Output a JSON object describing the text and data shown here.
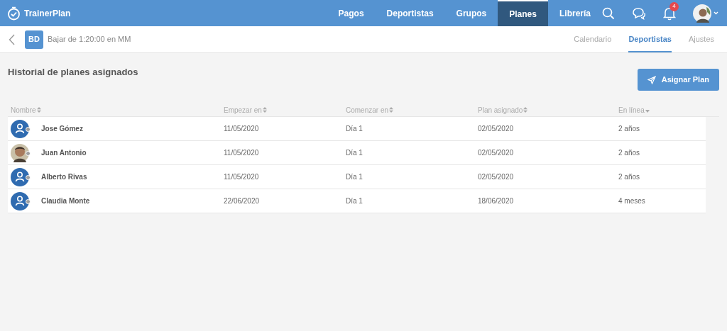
{
  "app": {
    "name": "TrainerPlan"
  },
  "nav": [
    {
      "label": "Pagos",
      "selected": false
    },
    {
      "label": "Deportistas",
      "selected": false
    },
    {
      "label": "Grupos",
      "selected": false
    },
    {
      "label": "Planes",
      "selected": true
    },
    {
      "label": "Librería",
      "selected": false
    }
  ],
  "notifications": {
    "count": "4"
  },
  "plan": {
    "initials": "BD",
    "title": "Bajar de 1:20:00 en MM"
  },
  "subtabs": [
    {
      "label": "Calendario",
      "selected": false
    },
    {
      "label": "Deportistas",
      "selected": true
    },
    {
      "label": "Ajustes",
      "selected": false
    }
  ],
  "section": {
    "title": "Historial de planes asignados",
    "button": "Asignar Plan"
  },
  "table": {
    "columns": [
      {
        "label": "Nombre",
        "kind": "sortable"
      },
      {
        "label": "Empezar en",
        "kind": "sortable"
      },
      {
        "label": "Comenzar en",
        "kind": "sortable"
      },
      {
        "label": "Plan asignado",
        "kind": "sortable"
      },
      {
        "label": "En línea",
        "kind": "sorted"
      }
    ],
    "rows": [
      {
        "kind": "default",
        "name": "Jose Gómez",
        "start": "11/05/2020",
        "begin": "Día 1",
        "assigned": "02/05/2020",
        "online": "2 años"
      },
      {
        "kind": "photo",
        "name": "Juan Antonio",
        "start": "11/05/2020",
        "begin": "Día 1",
        "assigned": "02/05/2020",
        "online": "2 años"
      },
      {
        "kind": "default",
        "name": "Alberto Rivas",
        "start": "11/05/2020",
        "begin": "Día 1",
        "assigned": "02/05/2020",
        "online": "2 años"
      },
      {
        "kind": "default",
        "name": "Claudia Monte",
        "start": "22/06/2020",
        "begin": "Día 1",
        "assigned": "18/06/2020",
        "online": "4 meses"
      }
    ]
  }
}
